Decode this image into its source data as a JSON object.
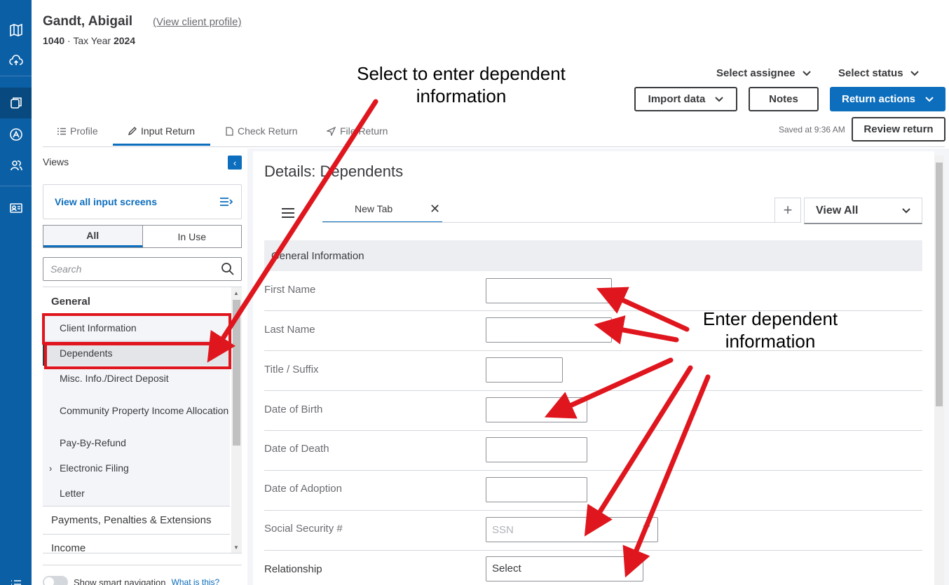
{
  "header": {
    "client_name": "Gandt, Abigail",
    "client_link": "(View client profile)",
    "form": "1040",
    "sep": " · Tax Year ",
    "year": "2024",
    "select_assignee": "Select assignee",
    "select_status": "Select status",
    "import_data": "Import data",
    "notes": "Notes",
    "return_actions": "Return actions",
    "saved": "Saved at 9:36 AM",
    "review_return": "Review return"
  },
  "tabs": [
    {
      "label": "Profile",
      "icon": "list-icon"
    },
    {
      "label": "Input Return",
      "icon": "pencil-icon"
    },
    {
      "label": "Check Return",
      "icon": "document-icon"
    },
    {
      "label": "File Return",
      "icon": "send-icon"
    }
  ],
  "left_panel": {
    "views": "Views",
    "view_all_screens": "View all input screens",
    "seg_all": "All",
    "seg_in_use": "In Use",
    "search_placeholder": "Search",
    "tree": {
      "general": "General",
      "items": [
        "Client Information",
        "Dependents",
        "Misc. Info./Direct Deposit",
        "Community Property Income Allocation",
        "Pay-By-Refund",
        "Electronic Filing",
        "Letter"
      ],
      "payments": "Payments, Penalties & Extensions",
      "income": "Income"
    },
    "smart_nav": "Show smart navigation",
    "what_is_this": "What is this?"
  },
  "main": {
    "title": "Details: Dependents",
    "new_tab": "New Tab",
    "view_all": "View All",
    "section": "General Information",
    "fields": {
      "first_name": "First Name",
      "last_name": "Last Name",
      "title_suffix": "Title / Suffix",
      "dob": "Date of Birth",
      "dod": "Date of Death",
      "adoption": "Date of Adoption",
      "ssn": "Social Security #",
      "ssn_placeholder": "SSN",
      "relationship": "Relationship",
      "relationship_value": "Select"
    }
  },
  "annotations": {
    "callout_1_line1": "Select to enter dependent",
    "callout_1_line2": "information",
    "callout_2_line1": "Enter dependent",
    "callout_2_line2": "information",
    "color": "#e0161e"
  },
  "colors": {
    "rail": "#0b5fa5",
    "accent": "#0d6ebd"
  }
}
